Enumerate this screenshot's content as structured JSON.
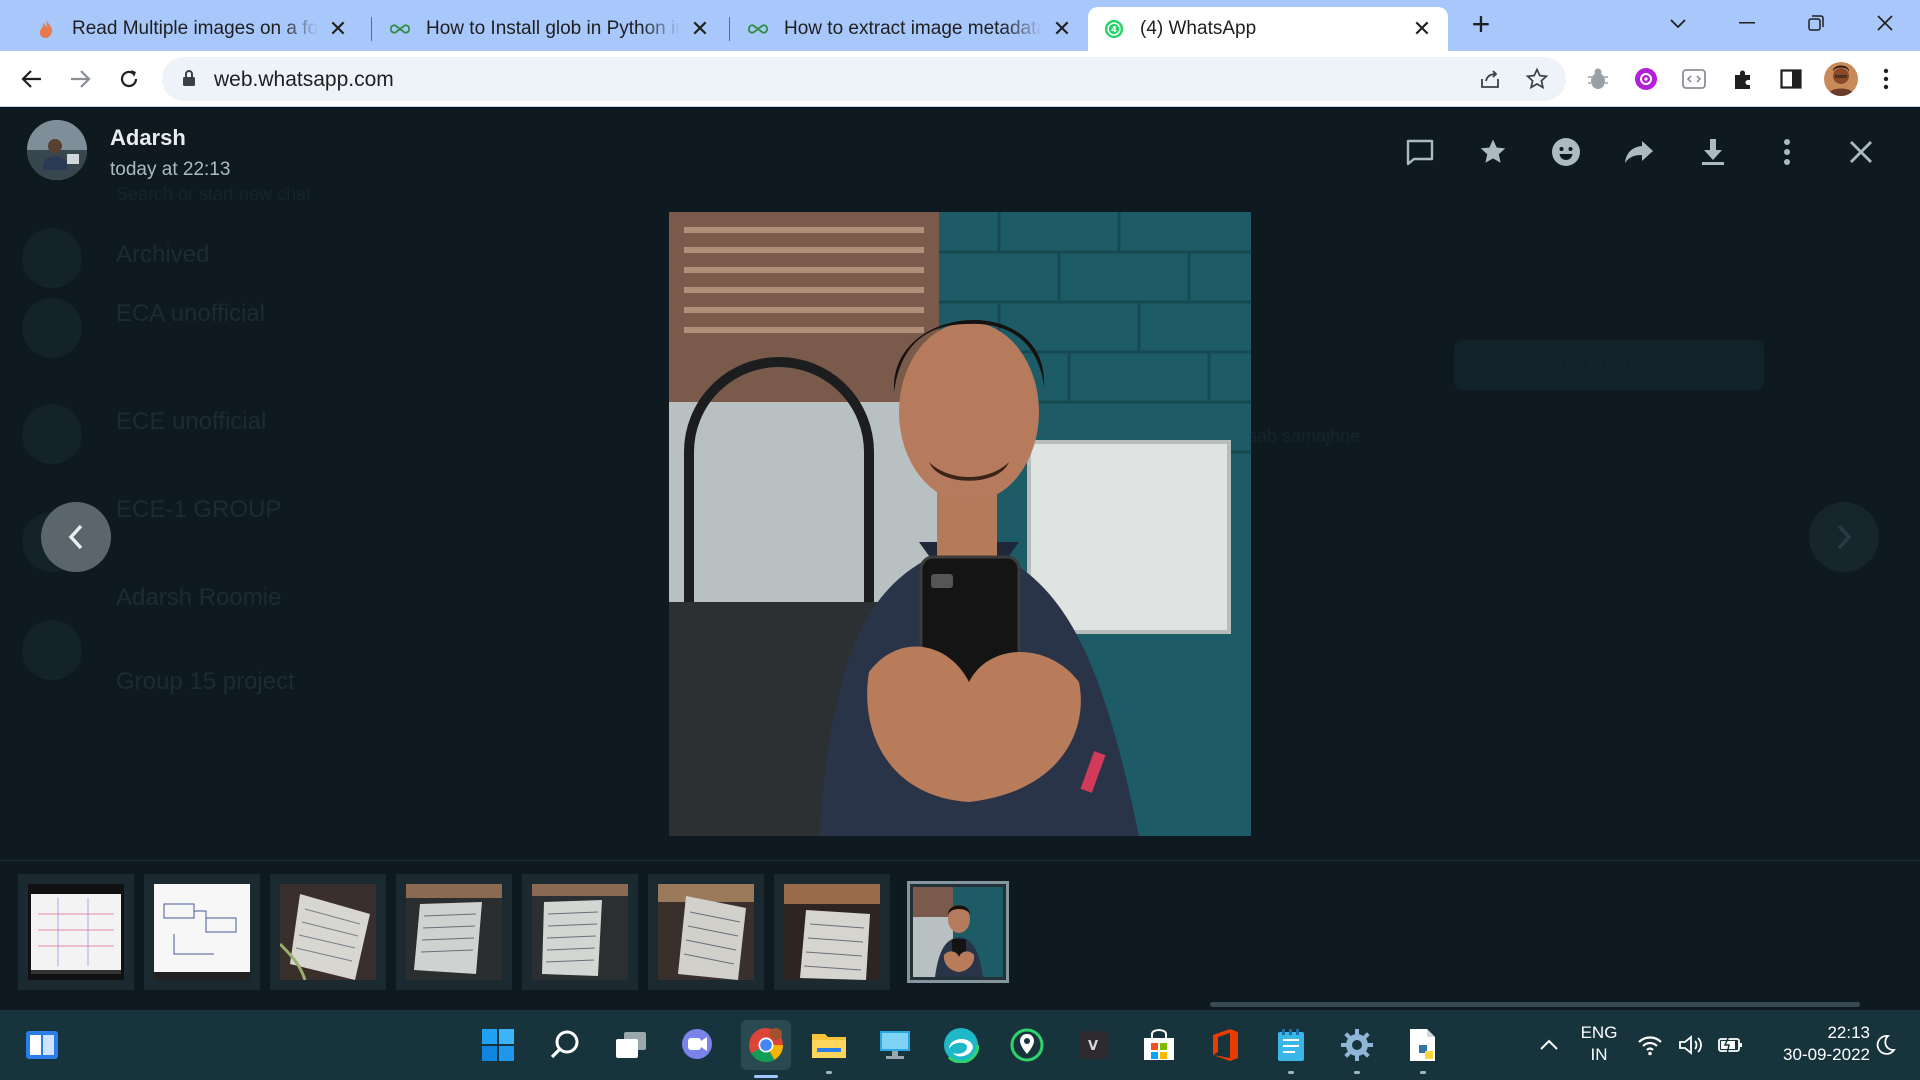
{
  "browser": {
    "tabs": [
      {
        "title": "Read Multiple images on a folder",
        "icon": "flame-favicon",
        "active": false
      },
      {
        "title": "How to Install glob in Python in Windows",
        "icon": "geeksforgeeks-favicon",
        "active": false
      },
      {
        "title": "How to extract image metadata in Python",
        "icon": "geeksforgeeks-favicon",
        "active": false
      },
      {
        "title": "(4) WhatsApp",
        "icon": "whatsapp-favicon",
        "active": true
      }
    ],
    "url": "web.whatsapp.com"
  },
  "viewer": {
    "sender_name": "Adarsh",
    "timestamp": "today at 22:13",
    "actions": [
      "reply-icon",
      "star-icon",
      "emoji-icon",
      "forward-icon",
      "download-icon",
      "more-icon",
      "close-icon"
    ],
    "thumbnails": [
      {
        "kind": "document-screenshot"
      },
      {
        "kind": "diagram-screenshot"
      },
      {
        "kind": "handwritten-notes-photo"
      },
      {
        "kind": "handwritten-notes-photo"
      },
      {
        "kind": "handwritten-notes-photo"
      },
      {
        "kind": "handwritten-notes-photo"
      },
      {
        "kind": "handwritten-notes-photo"
      },
      {
        "kind": "selfie-photo",
        "selected": true
      }
    ]
  },
  "background_chat": {
    "chats": [
      {
        "name": "Archived"
      },
      {
        "name": "ECA unofficial"
      },
      {
        "name": "ECE unofficial"
      },
      {
        "name": "ECE-1 GROUP"
      },
      {
        "name": "Adarsh Roomie"
      },
      {
        "name": "Group 15 project"
      }
    ],
    "bubble": "apni ek photo bhejdo",
    "bubble2": "sab samajhne"
  },
  "taskbar": {
    "apps": [
      "start-icon",
      "search-icon",
      "task-view-icon",
      "teams-chat-icon",
      "chrome-icon",
      "file-explorer-icon",
      "remote-desktop-icon",
      "edge-icon",
      "maps-icon",
      "terminal-icon",
      "store-icon",
      "office-icon",
      "notepad-icon",
      "settings-icon",
      "python-file-icon"
    ],
    "language": "ENG",
    "region": "IN",
    "time": "22:13",
    "date": "30-09-2022"
  },
  "colors": {
    "viewer_bg": "#0e1a20",
    "tabbar_bg": "#a8c7fa",
    "taskbar_bg": "#17343c"
  }
}
